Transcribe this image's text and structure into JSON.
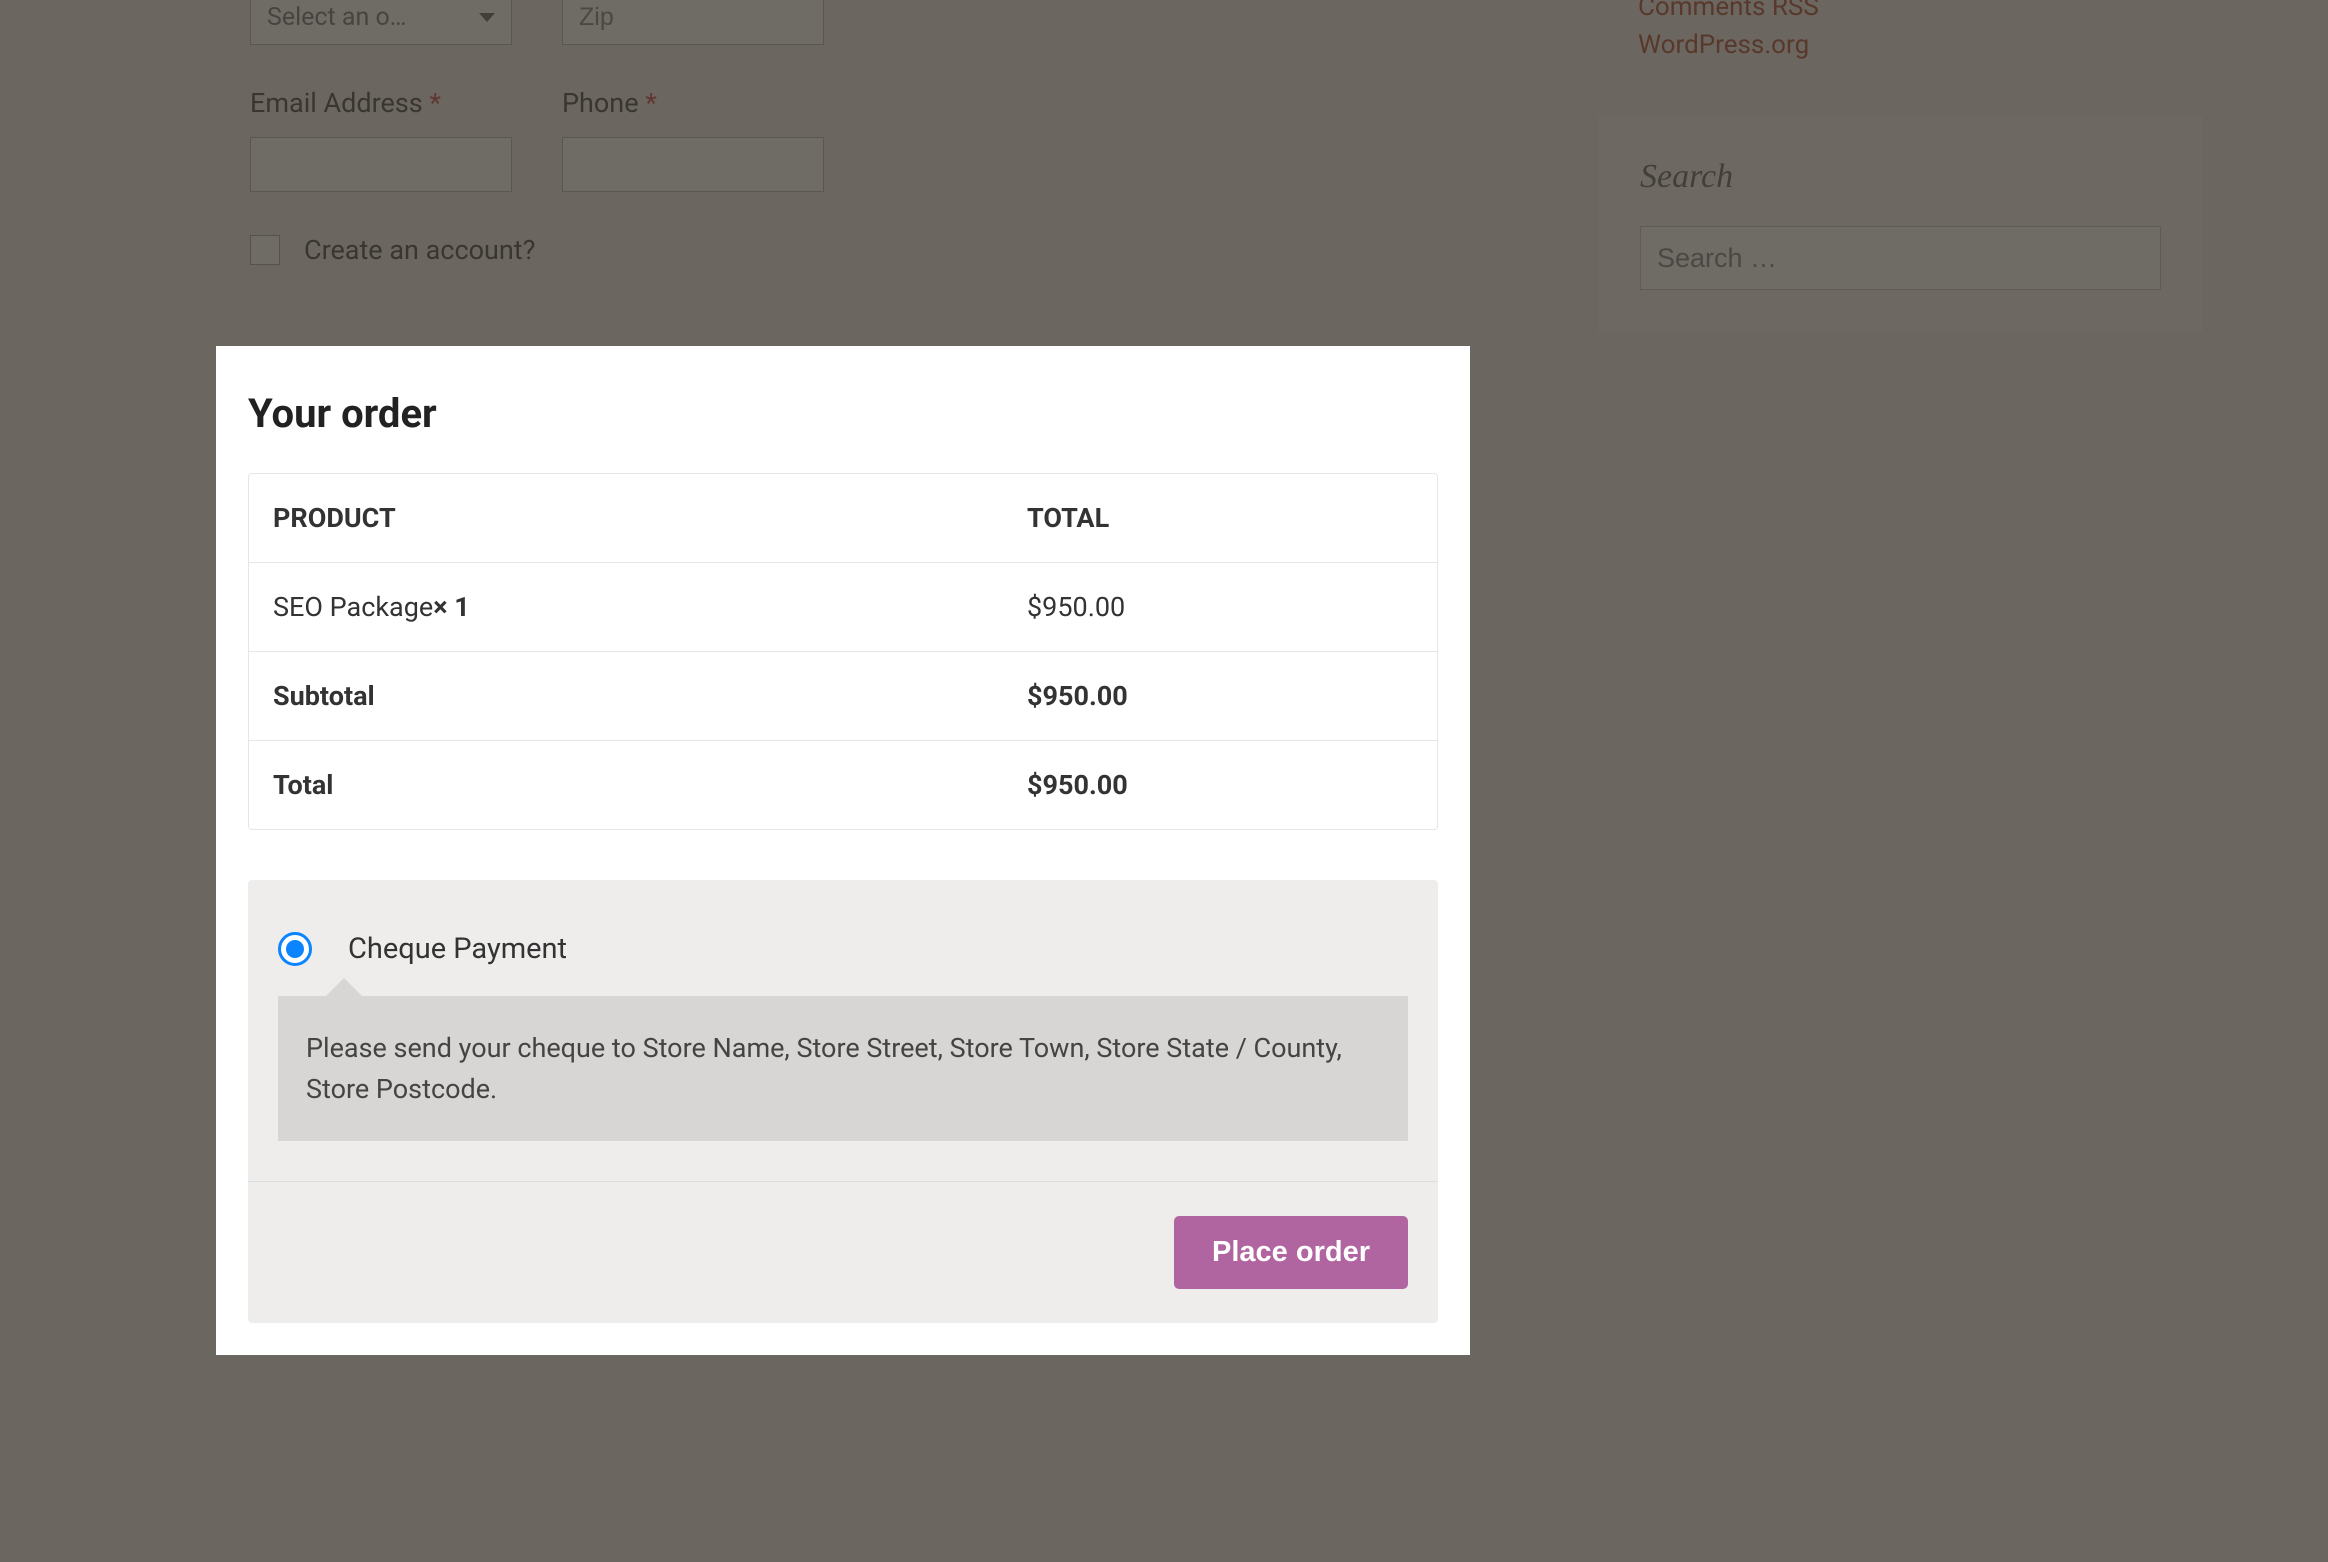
{
  "form": {
    "select_placeholder": "Select an o…",
    "zip_placeholder": "Zip",
    "email_label": "Email Address",
    "phone_label": "Phone",
    "required_mark": "*",
    "create_account_label": "Create an account?"
  },
  "sidebar": {
    "comments_text": "Comments RSS",
    "wordpress_link": "WordPress.org",
    "search_title": "Search",
    "search_placeholder": "Search …"
  },
  "order": {
    "title": "Your order",
    "header_product": "Product",
    "header_total": "Total",
    "product_name": "SEO Package",
    "product_qty": "× 1",
    "product_price": "$950.00",
    "subtotal_label": "Subtotal",
    "subtotal_value": "$950.00",
    "total_label": "Total",
    "total_value": "$950.00"
  },
  "payment": {
    "method_label": "Cheque Payment",
    "method_desc": "Please send your cheque to Store Name, Store Street, Store Town, Store State / County, Store Postcode.",
    "place_order_btn": "Place order"
  }
}
